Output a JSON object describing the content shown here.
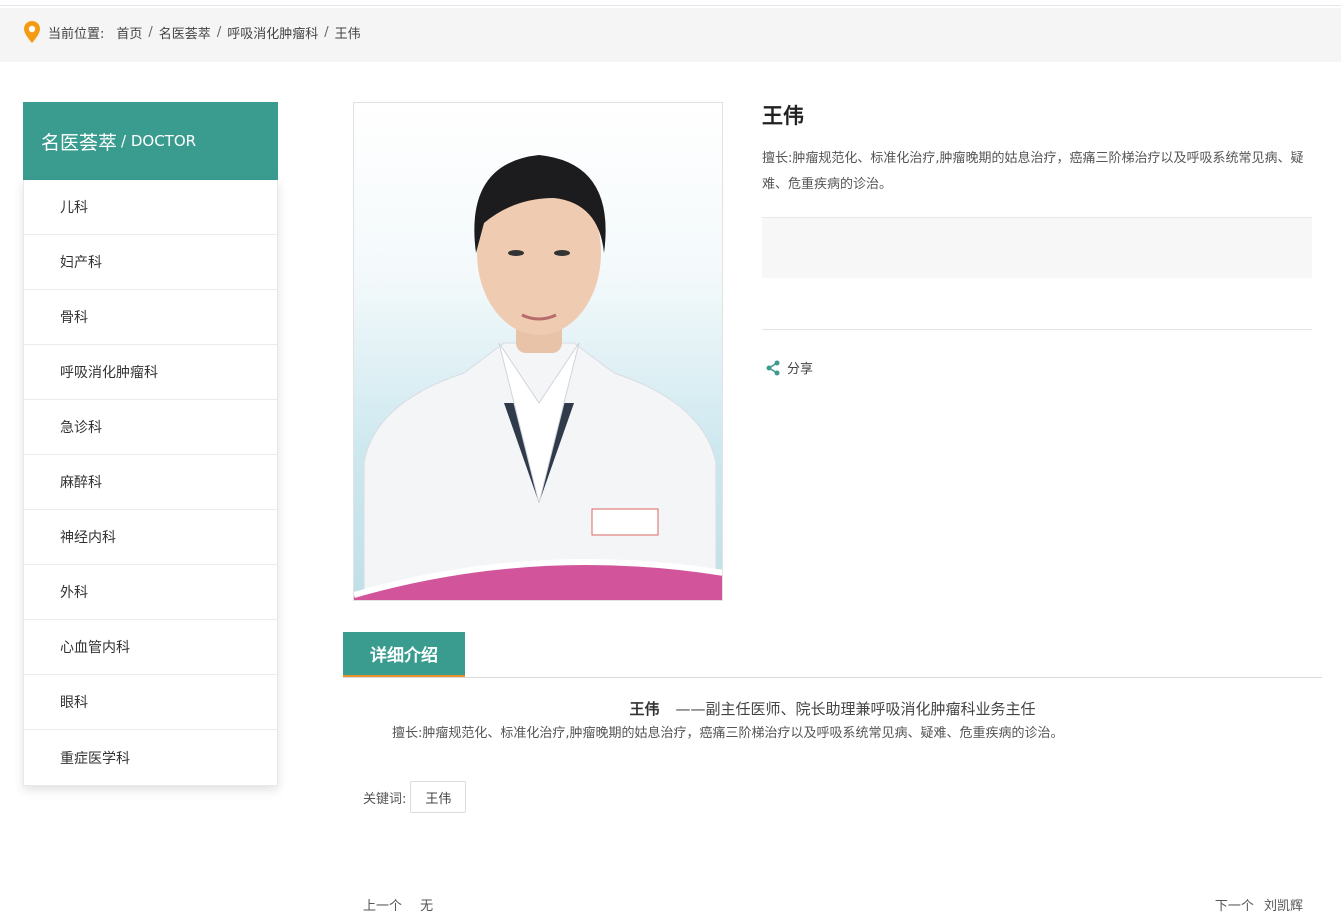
{
  "breadcrumb": {
    "prefix": "当前位置:",
    "items": [
      "首页",
      "名医荟萃",
      "呼吸消化肿瘤科",
      "王伟"
    ],
    "separator": "/"
  },
  "sidebar": {
    "title": "名医荟萃",
    "title_en": "/ DOCTOR",
    "items": [
      {
        "label": "儿科"
      },
      {
        "label": "妇产科"
      },
      {
        "label": "骨科"
      },
      {
        "label": "呼吸消化肿瘤科"
      },
      {
        "label": "急诊科"
      },
      {
        "label": "麻醉科"
      },
      {
        "label": "神经内科"
      },
      {
        "label": "外科"
      },
      {
        "label": "心血管内科"
      },
      {
        "label": "眼科"
      },
      {
        "label": "重症医学科"
      }
    ]
  },
  "doctor": {
    "name": "王伟",
    "specialty": "擅长:肿瘤规范化、标准化治疗,肿瘤晚期的姑息治疗，癌痛三阶梯治疗以及呼吸系统常见病、疑难、危重疾病的诊治。",
    "share_label": "分享"
  },
  "detail": {
    "tab_label": "详细介绍",
    "name": "王伟",
    "title": "——副主任医师、院长助理兼呼吸消化肿瘤科业务主任",
    "description": "擅长:肿瘤规范化、标准化治疗,肿瘤晚期的姑息治疗，癌痛三阶梯治疗以及呼吸系统常见病、疑难、危重疾病的诊治。",
    "keywords_label": "关键词:",
    "keywords": [
      "王伟"
    ]
  },
  "pagination": {
    "prev_label": "上一个",
    "prev_value": "无",
    "next_label": "下一个",
    "next_value": "刘凯辉"
  },
  "colors": {
    "accent": "#3a9c8f",
    "tab_underline": "#e8902a",
    "location_icon": "#f39c12"
  }
}
